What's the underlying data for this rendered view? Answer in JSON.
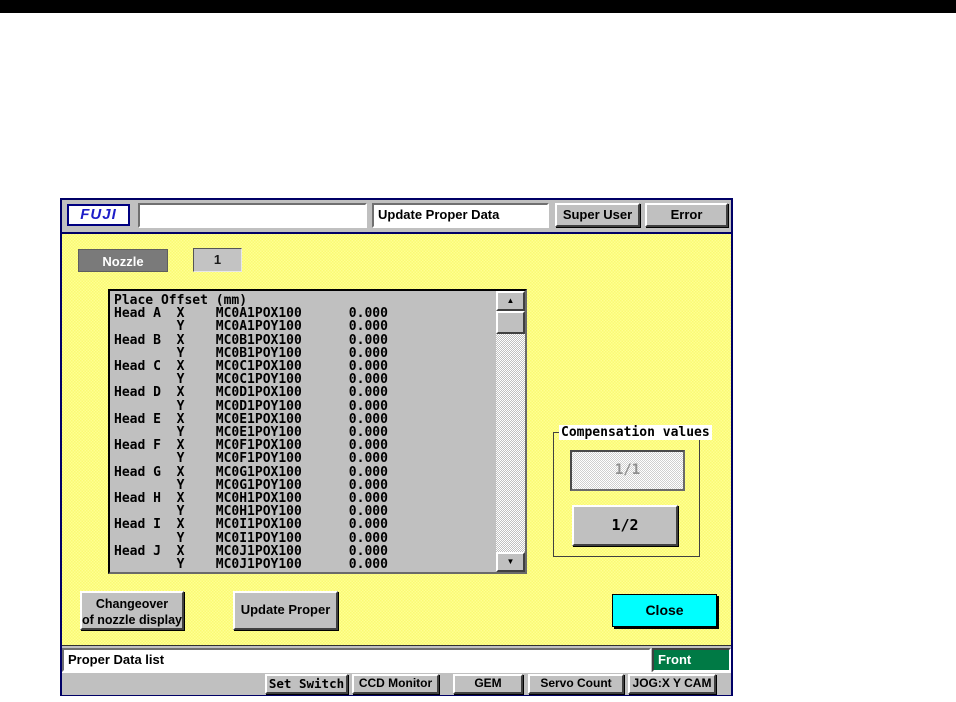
{
  "header": {
    "logo": "FUJI",
    "machine_field_value": "",
    "screen_title": "Update Proper Data",
    "super_user_button": "Super User",
    "error_button": "Error"
  },
  "nozzle": {
    "label": "Nozzle",
    "value": "1"
  },
  "list": {
    "lines": [
      "Place Offset (mm)",
      "Head A  X    MC0A1POX100      0.000",
      "        Y    MC0A1POY100      0.000",
      "Head B  X    MC0B1POX100      0.000",
      "        Y    MC0B1POY100      0.000",
      "Head C  X    MC0C1POX100      0.000",
      "        Y    MC0C1POY100      0.000",
      "Head D  X    MC0D1POX100      0.000",
      "        Y    MC0D1POY100      0.000",
      "Head E  X    MC0E1POX100      0.000",
      "        Y    MC0E1POY100      0.000",
      "Head F  X    MC0F1POX100      0.000",
      "        Y    MC0F1POY100      0.000",
      "Head G  X    MC0G1POX100      0.000",
      "        Y    MC0G1POY100      0.000",
      "Head H  X    MC0H1POX100      0.000",
      "        Y    MC0H1POY100      0.000",
      "Head I  X    MC0I1POX100      0.000",
      "        Y    MC0I1POY100      0.000",
      "Head J  X    MC0J1POX100      0.000",
      "        Y    MC0J1POY100      0.000"
    ]
  },
  "scrollbar": {
    "up_icon": "▲",
    "down_icon": "▼"
  },
  "compensation": {
    "label": "Compensation values",
    "ratio_1_1_button": "1/1",
    "ratio_1_2_button": "1/2"
  },
  "actions": {
    "changeover_line1": "Changeover",
    "changeover_line2": "of nozzle display",
    "update_proper_button": "Update Proper",
    "close_button": "Close"
  },
  "status": {
    "message": "Proper Data list",
    "side_indicator": "Front"
  },
  "footer": {
    "buttons": [
      "Set Switch",
      "CCD Monitor",
      "GEM",
      "Servo Count",
      "JOG:X Y CAM"
    ]
  },
  "colors": {
    "client_yellow": "#ffff87",
    "close_cyan": "#00ffff",
    "front_green": "#007a45",
    "logo_blue": "#1d1dc8",
    "window_border_navy": "#000066",
    "chrome_gray": "#c0c0c0"
  }
}
